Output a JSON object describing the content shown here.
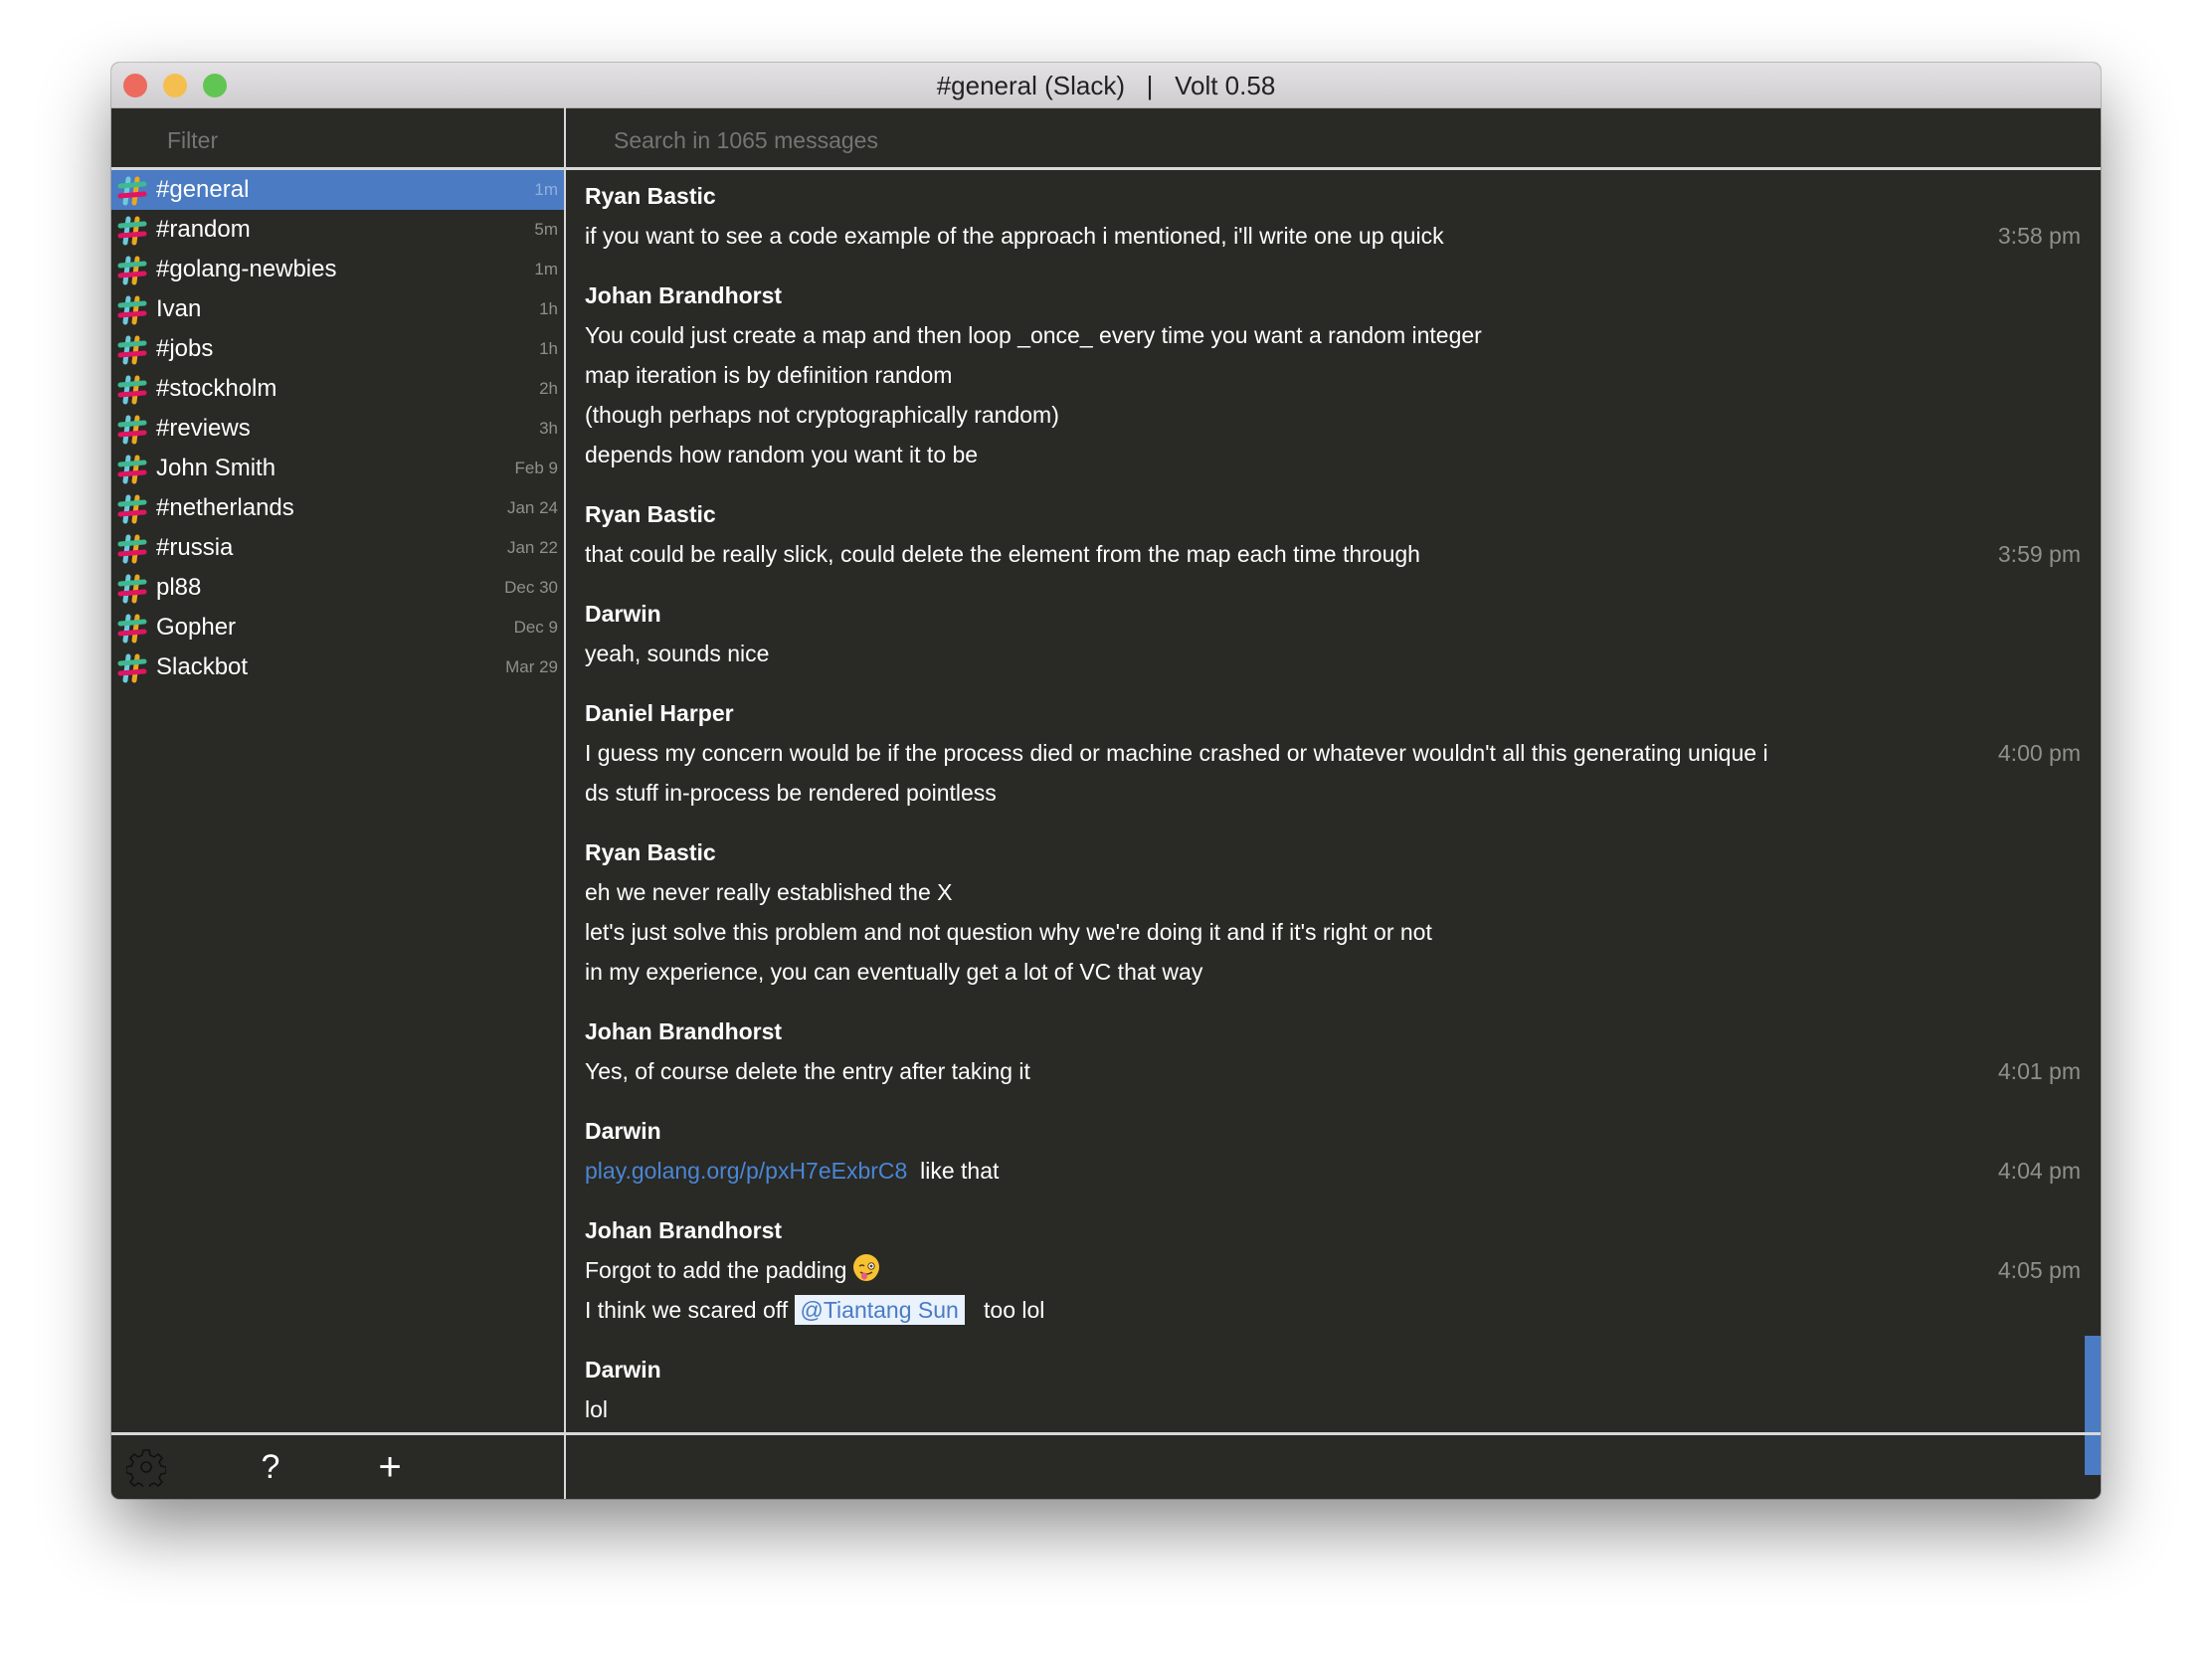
{
  "window": {
    "title": "#general (Slack)   |   Volt 0.58",
    "traffic_lights": {
      "close": "#ec6a5e",
      "minimize": "#f4bf4f",
      "zoom": "#61c554"
    }
  },
  "sidebar": {
    "filter_placeholder": "Filter",
    "accent": "#4a7bc3",
    "items": [
      {
        "label": "#general",
        "time": "1m",
        "active": true
      },
      {
        "label": "#random",
        "time": "5m"
      },
      {
        "label": "#golang-newbies",
        "time": "1m"
      },
      {
        "label": "Ivan",
        "time": "1h"
      },
      {
        "label": "#jobs",
        "time": "1h"
      },
      {
        "label": "#stockholm",
        "time": "2h"
      },
      {
        "label": "#reviews",
        "time": "3h"
      },
      {
        "label": "John Smith",
        "time": "Feb 9"
      },
      {
        "label": "#netherlands",
        "time": "Jan 24"
      },
      {
        "label": "#russia",
        "time": "Jan 22"
      },
      {
        "label": "pl88",
        "time": "Dec 30"
      },
      {
        "label": "Gopher",
        "time": "Dec 9"
      },
      {
        "label": "Slackbot",
        "time": "Mar 29"
      }
    ],
    "footer": {
      "settings_icon": "gear-icon",
      "help_label": "?",
      "add_label": "+"
    }
  },
  "main": {
    "search_placeholder": "Search in 1065 messages",
    "messages": [
      {
        "author": "Ryan Bastic",
        "lines": [
          {
            "segments": [
              {
                "text": "if you want to see a code example of the approach i mentioned, i'll write one up quick"
              }
            ],
            "time": "3:58 pm"
          }
        ]
      },
      {
        "author": "Johan Brandhorst",
        "lines": [
          {
            "segments": [
              {
                "text": "You could just create a map and then loop _once_ every time you want a random integer"
              }
            ]
          },
          {
            "segments": [
              {
                "text": "map iteration is by definition random"
              }
            ]
          },
          {
            "segments": [
              {
                "text": "(though perhaps not cryptographically random)"
              }
            ]
          },
          {
            "segments": [
              {
                "text": "depends how random you want it to be"
              }
            ]
          }
        ]
      },
      {
        "author": "Ryan Bastic",
        "lines": [
          {
            "segments": [
              {
                "text": "that could be really slick, could delete the element from the map each time through"
              }
            ],
            "time": "3:59 pm"
          }
        ]
      },
      {
        "author": "Darwin",
        "lines": [
          {
            "segments": [
              {
                "text": "yeah, sounds nice"
              }
            ]
          }
        ]
      },
      {
        "author": "Daniel Harper",
        "lines": [
          {
            "segments": [
              {
                "text": "I guess my concern would be if the process died or machine crashed or whatever wouldn't all this generating unique i"
              }
            ],
            "time": "4:00 pm"
          },
          {
            "segments": [
              {
                "text": "ds stuff in-process be rendered pointless"
              }
            ]
          }
        ]
      },
      {
        "author": "Ryan Bastic",
        "lines": [
          {
            "segments": [
              {
                "text": "eh we never really established the X"
              }
            ]
          },
          {
            "segments": [
              {
                "text": "let's just solve this problem and not question why we're doing it and if it's right or not"
              }
            ]
          },
          {
            "segments": [
              {
                "text": "in my experience, you can eventually get a lot of VC that way"
              }
            ]
          }
        ]
      },
      {
        "author": "Johan Brandhorst",
        "lines": [
          {
            "segments": [
              {
                "text": "Yes, of course delete the entry after taking it"
              }
            ],
            "time": "4:01 pm"
          }
        ]
      },
      {
        "author": "Darwin",
        "lines": [
          {
            "segments": [
              {
                "type": "link",
                "text": "play.golang.org/p/pxH7eExbrC8"
              },
              {
                "text": "  like that"
              }
            ],
            "time": "4:04 pm"
          }
        ]
      },
      {
        "author": "Johan Brandhorst",
        "lines": [
          {
            "segments": [
              {
                "text": "Forgot to add the padding "
              },
              {
                "type": "emoji",
                "text": "winking-face-with-tongue"
              }
            ],
            "time": "4:05 pm"
          },
          {
            "segments": [
              {
                "text": "I think we scared off "
              },
              {
                "type": "mention",
                "text": "@Tiantang Sun"
              },
              {
                "text": "   too lol"
              }
            ]
          }
        ]
      },
      {
        "author": "Darwin",
        "lines": [
          {
            "segments": [
              {
                "text": "lol"
              }
            ]
          }
        ]
      }
    ]
  }
}
